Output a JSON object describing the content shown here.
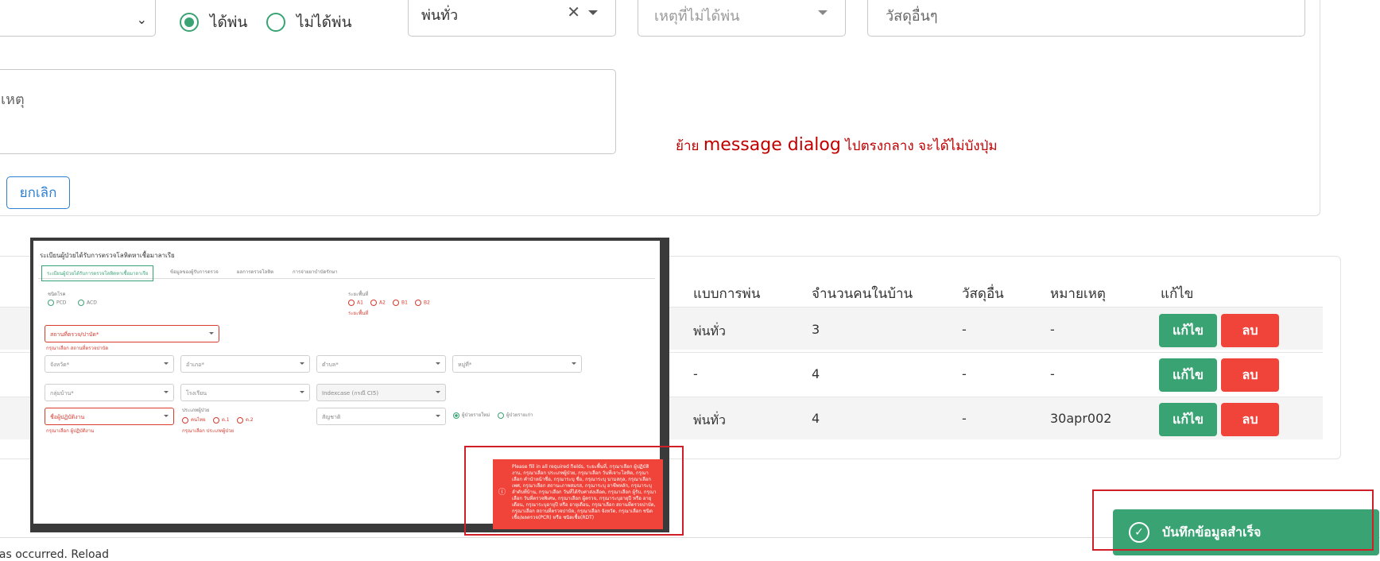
{
  "form": {
    "spray_status": {
      "option_yes": "ได้พ่น",
      "option_no": "ไม่ได้พ่น",
      "selected": "yes"
    },
    "spray_type": {
      "value": "พ่นทั่ว"
    },
    "not_spray_reason": {
      "placeholder": "เหตุที่ไม่ได้พ่น"
    },
    "other_material": {
      "placeholder": "วัสดุอื่นๆ"
    },
    "remark": {
      "placeholder": "เหตุ"
    },
    "cancel_label": "ยกเลิก"
  },
  "annotation": {
    "prefix": "ย้าย ",
    "big": "message dialog",
    "suffix": " ไปตรงกลาง จะได้ไม่บังปุ่ม"
  },
  "table": {
    "headers": [
      "แบบการพ่น",
      "จำนวนคนในบ้าน",
      "วัสดุอื่น",
      "หมายเหตุ",
      "แก้ไข"
    ],
    "rows": [
      {
        "spray": "พ่นทั่ว",
        "people": "3",
        "material": "-",
        "note": "-"
      },
      {
        "spray": "-",
        "people": "4",
        "material": "-",
        "note": "-"
      },
      {
        "spray": "พ่นทั่ว",
        "people": "4",
        "material": "-",
        "note": "30apr002"
      }
    ],
    "edit_label": "แก้ไข",
    "delete_label": "ลบ"
  },
  "embedded": {
    "title": "ระเบียนผู้ป่วยได้รับการตรวจโลหิตหาเชื้อมาลาเรีย",
    "tabs": [
      "ระเบียนผู้ป่วยได้รับการตรวจโลหิตหาเชื้อมาลาเรีย",
      "ข้อมูลของผู้รับการตรวจ",
      "ผลการตรวจโลหิต",
      "การจ่ายยาบำบัดรักษา"
    ],
    "type_label": "ชนิดโรค",
    "type_options": [
      "PCD",
      "ACD"
    ],
    "area_label": "ระยะพื้นที่",
    "area_options": [
      "A1",
      "A2",
      "B1",
      "B2"
    ],
    "area_error": "ระยะพื้นที่",
    "place_placeholder": "สถานที่ตรวจ/ปาบัด*",
    "place_error": "กรุณาเลือก สถานที่ตรวจปาบัด",
    "province": "จังหวัด*",
    "district": "อำเภอ*",
    "subdistrict": "ตำบล*",
    "village": "หมู่ที่*",
    "village_group": "กลุ่มบ้าน*",
    "school": "โรงเรียน",
    "indexcase": "Indexcase (กรณี CI5)",
    "new_patient": "ผู้ป่วยรายใหม่",
    "old_patient": "ผู้ป่วยรายเก่า",
    "operator": "ชื่อผู้ปฏิบัติงาน",
    "operator_error": "กรุณาเลือก ผู้ปฏิบัติงาน",
    "patient_type_label": "ประเภทผู้ป่วย",
    "patient_type_options": [
      "คนไทย",
      "ต.1",
      "ต.2"
    ],
    "patient_type_error": "กรุณาเลือก ประเภทผู้ป่วย",
    "nationality": "สัญชาติ",
    "error_message": "Please fill in all required fields, ระยะพื้นที่, กรุณาเลือก ผู้ปฏิบัติงาน, กรุณาเลือก ประเภทผู้ป่วย, กรุณาเลือก วันที่เจาะโลหิต, กรุณาเลือก คำนำหน้าชื่อ, กรุณาระบุ ชื่อ, กรุณาระบุ นามสกุล, กรุณาเลือก เพศ, กรุณาเลือก สถานะภาพสมรส, กรุณาระบุ อาชีพหลัก, กรุณาระบุ ลำดับที่บ้าน, กรุณาเลือก วันที่ได้รับค่าส่งเลือด, กรุณาเลือก ผู้รับ, กรุณาเลือก วันที่ตรวจพิเศษ, กรุณาเลือก ผู้ตรวจ, กรุณาระบุอายุปี หรือ อายุเดือน, กรุณาระบุอายุปี หรือ อายุเดือน, กรุณาเลือก สถานที่ตรวจปาบัด, กรุณาเลือก สถานที่ตรวจปาบัด, กรุณาเลือก จังหวัด, กรุณาเลือก ชนิดเชื้อ/ผลตรวจ(PCR) หรือ ชนิดเชื้อ(RDT)"
  },
  "toast": {
    "message": "บันทึกข้อมูลสำเร็จ"
  },
  "footer": {
    "error_text": "has occurred. Reload"
  },
  "colors": {
    "primary_green": "#3aa374",
    "danger_red": "#f0443a",
    "outline_blue": "#2f7fd0",
    "annotation_red": "#c00000"
  }
}
